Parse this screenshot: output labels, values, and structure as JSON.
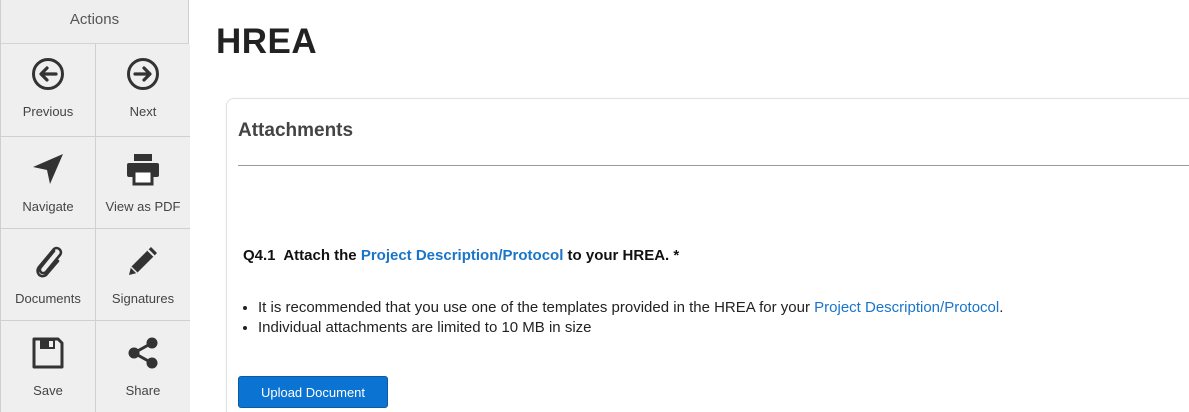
{
  "sidebar": {
    "title": "Actions",
    "items": [
      {
        "label": "Previous",
        "icon": "arrow-left-circle-icon"
      },
      {
        "label": "Next",
        "icon": "arrow-right-circle-icon"
      },
      {
        "label": "Navigate",
        "icon": "navigate-icon"
      },
      {
        "label": "View as PDF",
        "icon": "printer-icon"
      },
      {
        "label": "Documents",
        "icon": "paperclip-icon"
      },
      {
        "label": "Signatures",
        "icon": "pencil-icon"
      },
      {
        "label": "Save",
        "icon": "save-icon"
      },
      {
        "label": "Share",
        "icon": "share-icon"
      }
    ]
  },
  "main": {
    "title": "HREA",
    "section_title": "Attachments",
    "question": {
      "number": "Q4.1",
      "prefix": "Attach the",
      "link_text": "Project Description/Protocol",
      "suffix": "to your HREA. *"
    },
    "bullets": {
      "item1_text": "It is recommended that you use one of the templates provided in the HREA for your",
      "item1_link": "Project Description/Protocol",
      "item1_end": ".",
      "item2_text": "Individual attachments are limited to 10 MB in size"
    },
    "upload_button": "Upload Document"
  },
  "colors": {
    "link": "#1a75c9",
    "button": "#0b73d1",
    "sidebar_bg": "#f0f0f0"
  }
}
